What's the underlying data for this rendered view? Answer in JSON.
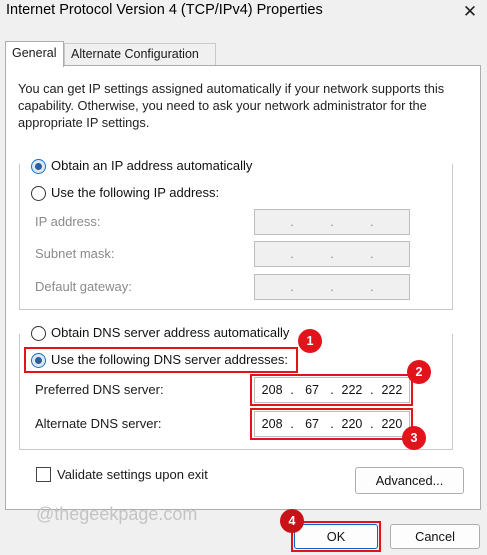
{
  "window": {
    "title": "Internet Protocol Version 4 (TCP/IPv4) Properties",
    "close_glyph": "✕"
  },
  "tabs": [
    {
      "label": "General",
      "active": true
    },
    {
      "label": "Alternate Configuration",
      "active": false
    }
  ],
  "intro_text": "You can get IP settings assigned automatically if your network supports this capability. Otherwise, you need to ask your network administrator for the appropriate IP settings.",
  "ip_section": {
    "auto_label": "Obtain an IP address automatically",
    "manual_label": "Use the following IP address:",
    "selected": "auto",
    "fields": [
      {
        "label": "IP address:",
        "value": ". . ."
      },
      {
        "label": "Subnet mask:",
        "value": ". . ."
      },
      {
        "label": "Default gateway:",
        "value": ". . ."
      }
    ]
  },
  "dns_section": {
    "auto_label": "Obtain DNS server address automatically",
    "manual_label": "Use the following DNS server addresses:",
    "selected": "manual",
    "preferred": {
      "label": "Preferred DNS server:",
      "octets": [
        "208",
        "67",
        "222",
        "222"
      ]
    },
    "alternate": {
      "label": "Alternate DNS server:",
      "octets": [
        "208",
        "67",
        "220",
        "220"
      ]
    }
  },
  "validate_label": "Validate settings upon exit",
  "validate_checked": false,
  "buttons": {
    "advanced": "Advanced...",
    "ok": "OK",
    "cancel": "Cancel"
  },
  "annotations": {
    "badge1": "1",
    "badge2": "2",
    "badge3": "3",
    "badge4": "4",
    "color": "#e3131c"
  },
  "watermark": "@thegeekpage.com"
}
